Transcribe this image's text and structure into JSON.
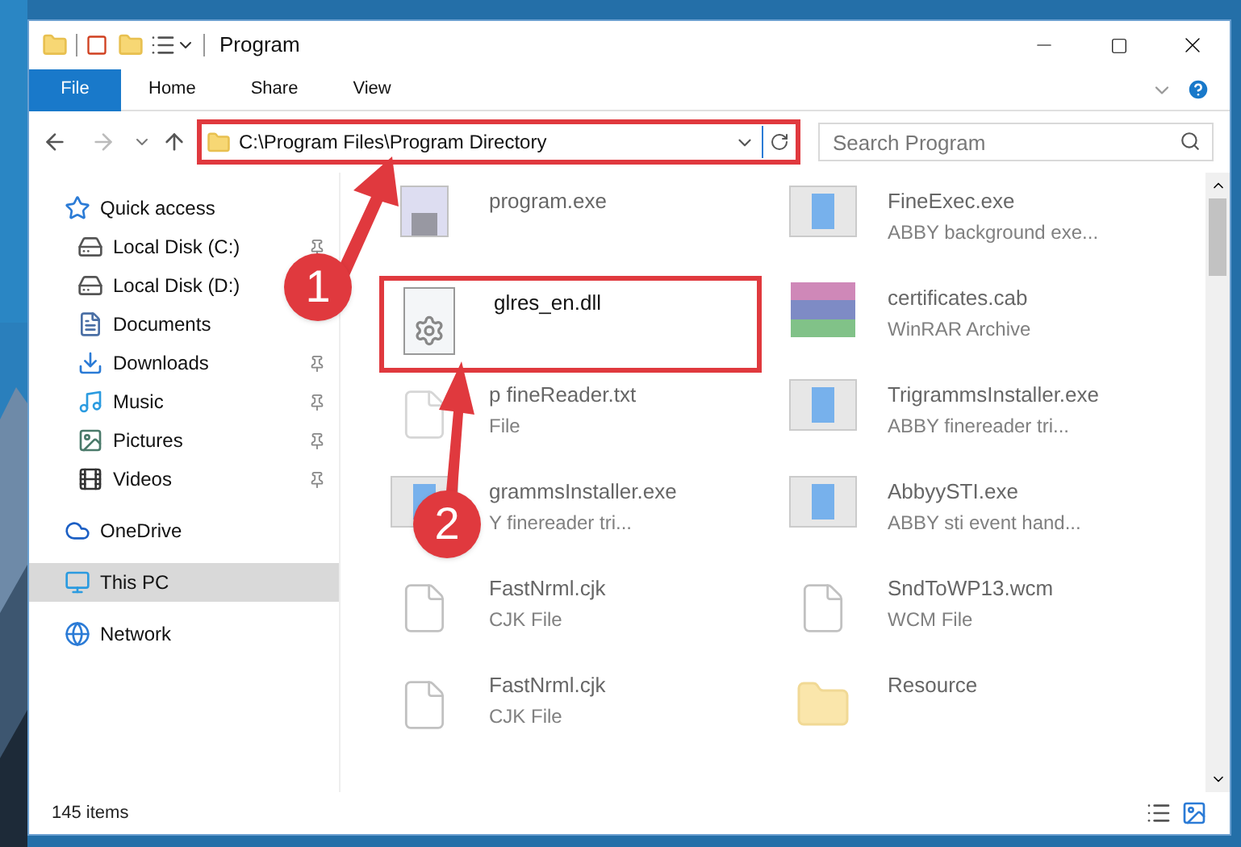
{
  "window": {
    "title": "Program"
  },
  "ribbon_tabs": [
    {
      "label": "File",
      "selected": true
    },
    {
      "label": "Home",
      "selected": false
    },
    {
      "label": "Share",
      "selected": false
    },
    {
      "label": "View",
      "selected": false
    }
  ],
  "address_bar": {
    "path": "C:\\Program Files\\Program Directory",
    "highlighted": true
  },
  "search": {
    "placeholder": "Search Program"
  },
  "sidebar": {
    "items": [
      {
        "label": "Quick access",
        "kind": "star",
        "selected": false,
        "children": [
          {
            "label": "Local Disk (C:)",
            "kind": "drive",
            "pinned": true,
            "selected": false
          },
          {
            "label": "Local Disk (D:)",
            "kind": "drive",
            "selected": false
          },
          {
            "label": "Documents",
            "kind": "document",
            "selected": false
          },
          {
            "label": "Downloads",
            "kind": "download",
            "pinned": true,
            "selected": false
          },
          {
            "label": "Music",
            "kind": "music",
            "pinned": true,
            "selected": false
          },
          {
            "label": "Pictures",
            "kind": "picture",
            "pinned": true,
            "selected": false
          },
          {
            "label": "Videos",
            "kind": "video",
            "pinned": true,
            "selected": false
          }
        ]
      },
      {
        "label": "OneDrive",
        "kind": "cloud",
        "selected": false
      },
      {
        "label": "This PC",
        "kind": "pc",
        "selected": true
      },
      {
        "label": "Network",
        "kind": "network",
        "selected": false
      }
    ]
  },
  "files": [
    {
      "name": "program.exe",
      "kind": "setup",
      "dimmed": true,
      "highlighted": false
    },
    {
      "name": "FineExec.exe",
      "type": "ABBY background exe...",
      "kind": "app",
      "dimmed": true,
      "highlighted": false
    },
    {
      "name": "glres_en.dll",
      "kind": "dll",
      "dimmed": false,
      "highlighted": true
    },
    {
      "name": "certificates.cab",
      "type": "WinRAR Archive",
      "kind": "archive",
      "dimmed": true,
      "highlighted": false
    },
    {
      "name": "p fineReader.txt",
      "type": "File",
      "kind": "text",
      "dimmed": true,
      "highlighted": false
    },
    {
      "name": "TrigrammsInstaller.exe",
      "type": "ABBY finereader tri...",
      "kind": "app",
      "dimmed": true,
      "highlighted": false
    },
    {
      "name": "grammsInstaller.exe",
      "type": "Y finereader tri...",
      "kind": "app",
      "dimmed": true,
      "highlighted": false
    },
    {
      "name": "AbbyySTI.exe",
      "type": "ABBY sti event hand...",
      "kind": "app",
      "dimmed": true,
      "highlighted": false
    },
    {
      "name": "FastNrml.cjk",
      "type": "CJK File",
      "kind": "blank",
      "dimmed": true,
      "highlighted": false
    },
    {
      "name": "SndToWP13.wcm",
      "type": "WCM File",
      "kind": "blank",
      "dimmed": true,
      "highlighted": false
    },
    {
      "name": "FastNrml.cjk",
      "type": "CJK File",
      "kind": "blank",
      "dimmed": true,
      "highlighted": false
    },
    {
      "name": "Resource",
      "kind": "folder",
      "dimmed": true,
      "highlighted": false
    }
  ],
  "status_bar": {
    "item_count": "145 items"
  },
  "annotations": [
    {
      "number": "1"
    },
    {
      "number": "2"
    }
  ]
}
